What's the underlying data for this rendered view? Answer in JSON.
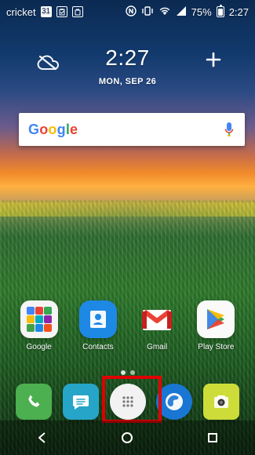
{
  "status_bar": {
    "carrier": "cricket",
    "calendar_badge": "31",
    "battery_percent": "75%",
    "time": "2:27",
    "icons": [
      "calendar-icon",
      "clipboard-icon",
      "briefcase-icon",
      "nfc-icon",
      "vibrate-icon",
      "wifi-icon",
      "cellular-signal-icon",
      "battery-icon"
    ]
  },
  "widget": {
    "time": "2:27",
    "date": "MON, SEP 26",
    "weather_icon": "weather-cloud-off-icon",
    "add_icon": "plus-icon"
  },
  "search": {
    "brand": "Google",
    "mic_icon": "microphone-icon"
  },
  "home_apps": [
    {
      "label": "Google",
      "icon": "google-apps-folder-icon"
    },
    {
      "label": "Contacts",
      "icon": "contacts-icon"
    },
    {
      "label": "Gmail",
      "icon": "gmail-icon"
    },
    {
      "label": "Play Store",
      "icon": "play-store-icon"
    }
  ],
  "dock": [
    {
      "icon": "phone-icon"
    },
    {
      "icon": "messages-icon"
    },
    {
      "icon": "app-drawer-icon"
    },
    {
      "icon": "browser-icon"
    },
    {
      "icon": "camera-icon"
    }
  ],
  "nav": {
    "back_icon": "back-icon",
    "home_icon": "home-icon",
    "recents_icon": "recents-icon"
  },
  "highlight": {
    "color": "#e00000"
  }
}
